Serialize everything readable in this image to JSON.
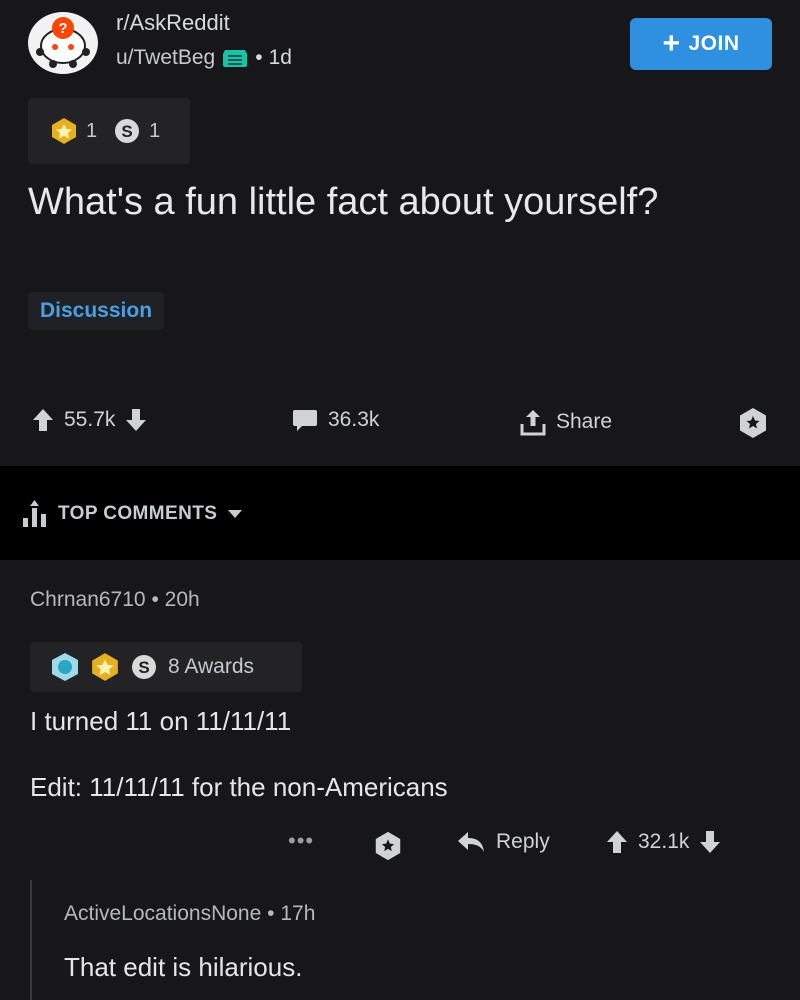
{
  "header": {
    "subreddit": "r/AskReddit",
    "author": "u/TwetBeg",
    "separator": "•",
    "age": "1d",
    "join_label": "JOIN"
  },
  "post": {
    "awards": {
      "gold_count": "1",
      "silver_count": "1"
    },
    "title": "What's a fun little fact about yourself?",
    "flair": "Discussion",
    "score": "55.7k",
    "comments": "36.3k",
    "share_label": "Share"
  },
  "sort": {
    "label": "TOP COMMENTS"
  },
  "comments": [
    {
      "author": "Chrnan6710",
      "age": "20h",
      "awards_label": "8 Awards",
      "body": [
        "I turned 11 on 11/11/11",
        "Edit: 11/11/11 for the non-Americans"
      ],
      "more_label": "•••",
      "reply_label": "Reply",
      "score": "32.1k"
    },
    {
      "author": "ActiveLocationsNone",
      "age": "17h",
      "body": [
        "That edit is hilarious."
      ]
    }
  ],
  "colors": {
    "background": "#17171a",
    "accent": "#2f8fe0",
    "flair_text": "#4a9fe4",
    "band": "#000000"
  },
  "icons": [
    "snoo-avatar-icon",
    "flair-badge-icon",
    "gold-award-icon",
    "silver-award-icon",
    "upvote-icon",
    "downvote-icon",
    "comment-icon",
    "share-icon",
    "save-icon",
    "top-sort-icon",
    "caret-down-icon",
    "platinum-award-icon",
    "reply-arrow-icon"
  ]
}
